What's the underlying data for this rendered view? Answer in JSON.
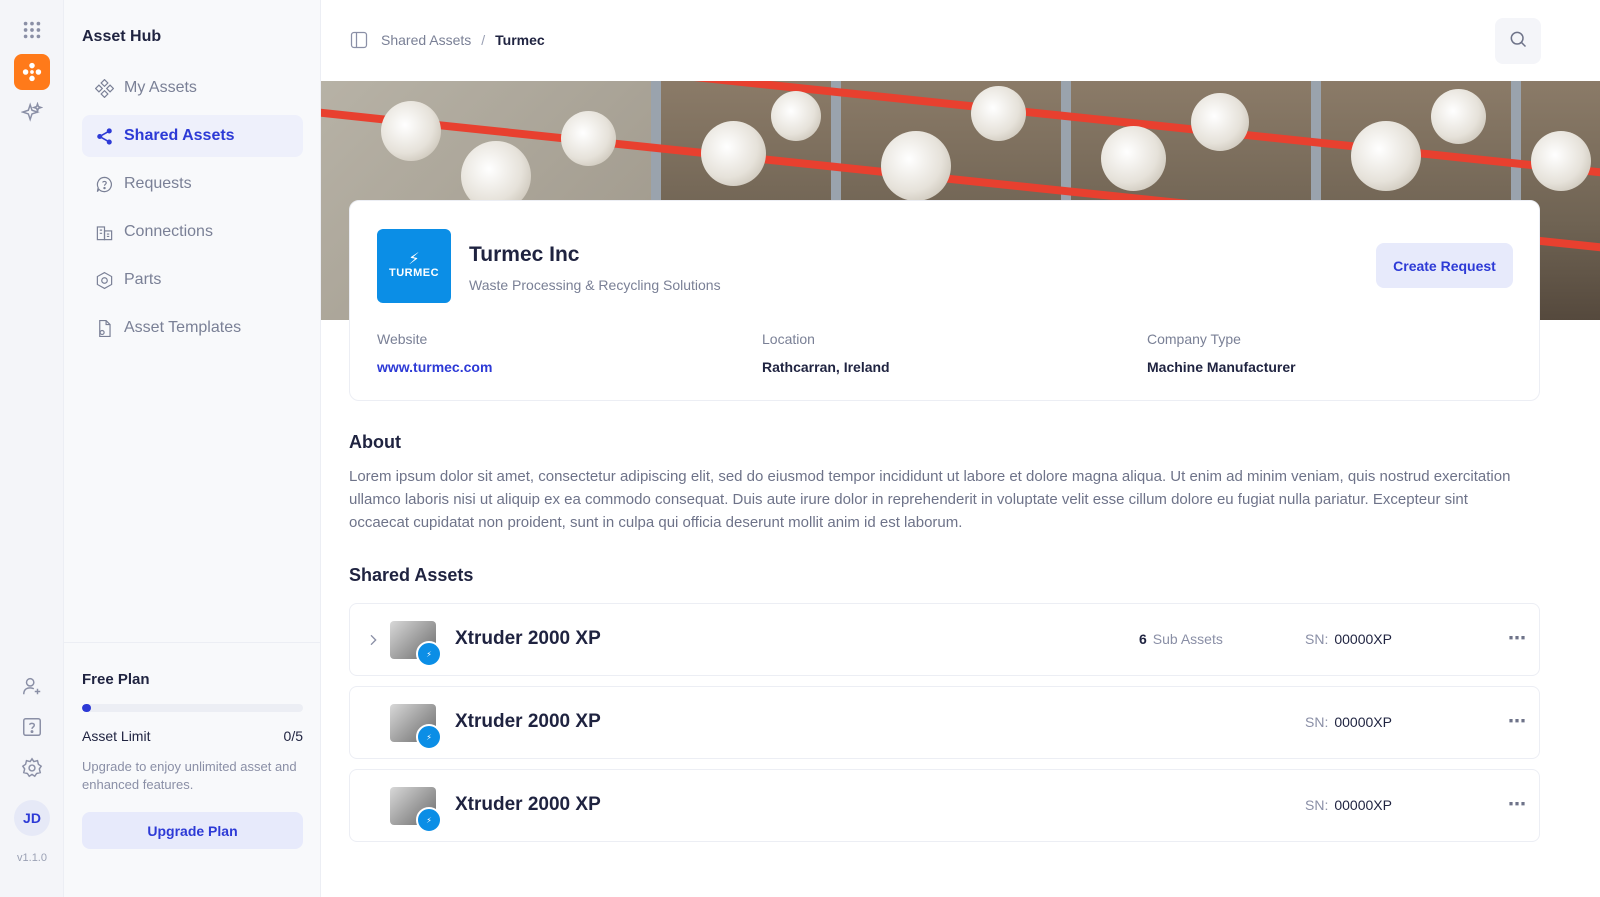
{
  "rail": {
    "avatar_initials": "JD",
    "version": "v1.1.0",
    "brand_color": "#ff7a1a"
  },
  "sidebar": {
    "title": "Asset Hub",
    "items": [
      {
        "label": "My Assets",
        "icon": "diamond-grid-icon",
        "active": false
      },
      {
        "label": "Shared Assets",
        "icon": "share-icon",
        "active": true
      },
      {
        "label": "Requests",
        "icon": "question-bubble-icon",
        "active": false
      },
      {
        "label": "Connections",
        "icon": "building-icon",
        "active": false
      },
      {
        "label": "Parts",
        "icon": "gear-hex-icon",
        "active": false
      },
      {
        "label": "Asset Templates",
        "icon": "document-icon",
        "active": false
      }
    ],
    "plan": {
      "title": "Free Plan",
      "limit_label": "Asset Limit",
      "limit_value": "0/5",
      "usage_fraction": 0,
      "description": "Upgrade to enjoy unlimited asset and enhanced features.",
      "upgrade_label": "Upgrade Plan"
    }
  },
  "breadcrumb": {
    "parent": "Shared Assets",
    "separator": "/",
    "current": "Turmec"
  },
  "company": {
    "logo_text": "TURMEC",
    "name": "Turmec Inc",
    "subtitle": "Waste Processing & Recycling Solutions",
    "create_request_label": "Create Request",
    "website_label": "Website",
    "website_value": "www.turmec.com",
    "location_label": "Location",
    "location_value": "Rathcarran, Ireland",
    "type_label": "Company Type",
    "type_value": "Machine Manufacturer"
  },
  "about": {
    "title": "About",
    "text": "Lorem ipsum dolor sit amet, consectetur adipiscing elit, sed do eiusmod tempor incididunt ut labore et dolore magna aliqua. Ut enim ad minim veniam, quis nostrud exercitation ullamco laboris nisi ut aliquip ex ea commodo consequat. Duis aute irure dolor in reprehenderit in voluptate velit esse cillum dolore eu fugiat nulla pariatur. Excepteur sint occaecat cupidatat non proident, sunt in culpa qui officia deserunt mollit anim id est laborum."
  },
  "shared_assets": {
    "title": "Shared Assets",
    "rows": [
      {
        "name": "Xtruder 2000 XP",
        "sub_count": "6",
        "sub_label": "Sub Assets",
        "sn_label": "SN:",
        "sn_value": "00000XP",
        "expandable": true
      },
      {
        "name": "Xtruder 2000 XP",
        "sn_label": "SN:",
        "sn_value": "00000XP",
        "expandable": false
      },
      {
        "name": "Xtruder 2000 XP",
        "sn_label": "SN:",
        "sn_value": "00000XP",
        "expandable": false
      }
    ]
  },
  "colors": {
    "accent": "#2d3ad6",
    "accent_soft": "#e7eafb",
    "logo_blue": "#0b8ee6"
  }
}
